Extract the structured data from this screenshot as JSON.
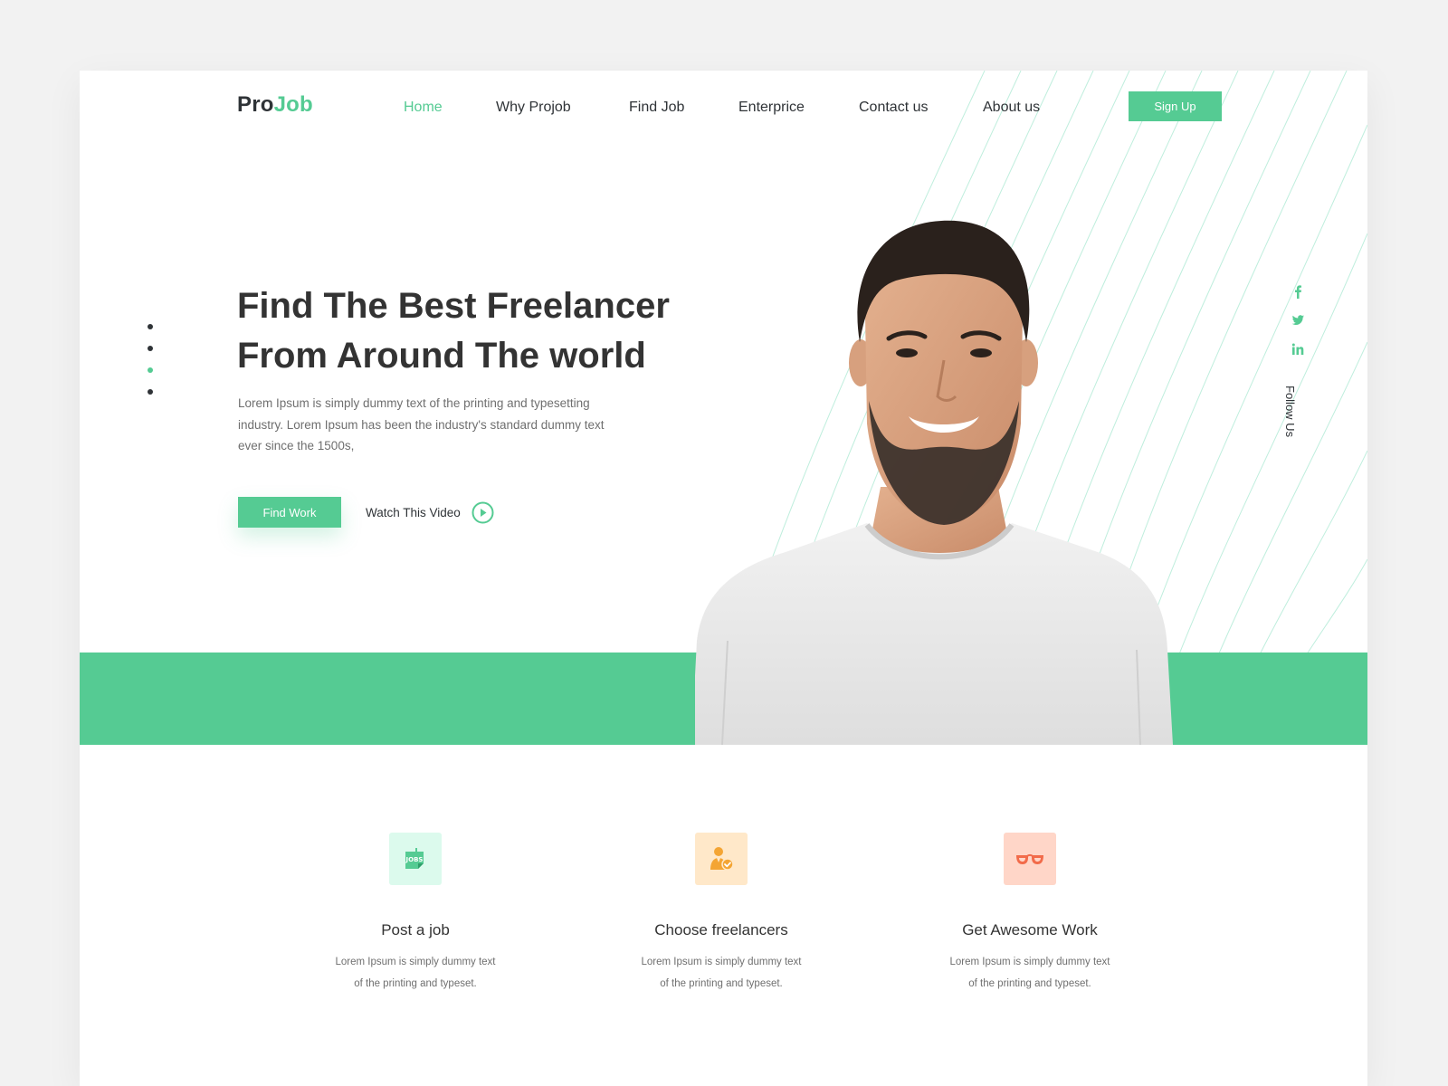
{
  "brand": {
    "part1": "Pro",
    "part2": "Job"
  },
  "nav": {
    "items": [
      {
        "label": "Home",
        "active": true
      },
      {
        "label": "Why Projob",
        "active": false
      },
      {
        "label": "Find Job",
        "active": false
      },
      {
        "label": "Enterprice",
        "active": false
      },
      {
        "label": "Contact us",
        "active": false
      },
      {
        "label": "About us",
        "active": false
      }
    ],
    "signup_label": "Sign Up"
  },
  "slider": {
    "count": 4,
    "active_index": 2
  },
  "hero": {
    "title_line1": "Find The Best Freelancer",
    "title_line2": "From Around The world",
    "description": "Lorem Ipsum is simply dummy text of the printing and typesetting industry. Lorem Ipsum has been the industry's standard dummy text ever since the 1500s,",
    "primary_cta": "Find Work",
    "video_cta": "Watch This Video"
  },
  "social": {
    "icons": [
      "facebook-icon",
      "twitter-icon",
      "linkedin-icon"
    ],
    "label": "Follow Us"
  },
  "features": [
    {
      "icon": "jobs-icon",
      "icon_bg": "#dcfaed",
      "title": "Post a job",
      "desc_line1": "Lorem Ipsum is simply dummy text",
      "desc_line2": "of the printing and typeset."
    },
    {
      "icon": "freelancer-check-icon",
      "icon_bg": "#ffe8c9",
      "title": "Choose freelancers",
      "desc_line1": "Lorem Ipsum is simply dummy text",
      "desc_line2": "of the printing and typeset."
    },
    {
      "icon": "glasses-icon",
      "icon_bg": "#ffd6c8",
      "title": "Get Awesome Work",
      "desc_line1": "Lorem Ipsum is simply dummy text",
      "desc_line2": "of the printing and typeset."
    }
  ],
  "colors": {
    "accent": "#55cb93",
    "text_dark": "#2f3337",
    "text_muted": "#6f6f6f",
    "page_bg": "#f2f2f2"
  }
}
